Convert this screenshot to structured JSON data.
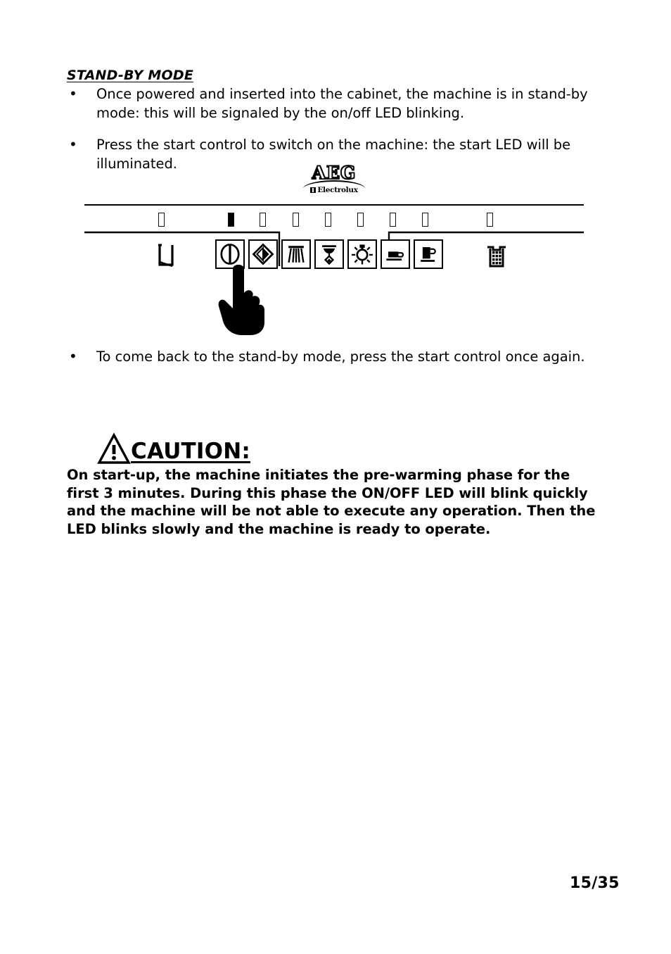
{
  "document": {
    "section_heading": "STAND-BY MODE",
    "page_number": "15/35"
  },
  "bullets": [
    {
      "marker": "•",
      "text": "Once powered and inserted into the cabinet, the machine is in stand-by mode: this will be signaled by the on/off LED blinking."
    },
    {
      "marker": "•",
      "text": "Press the start control to switch on the machine: the start LED will be illuminated."
    },
    {
      "marker": "•",
      "text": "To come back to the stand-by mode, press the start control once again."
    }
  ],
  "figure": {
    "brand": {
      "name": "AEG",
      "sub": "Electrolux"
    },
    "leds": [
      {
        "name": "led-water-tank",
        "state": "off"
      },
      {
        "name": "led-on-off",
        "state": "on"
      },
      {
        "name": "led-rinse",
        "state": "off"
      },
      {
        "name": "led-steam",
        "state": "off"
      },
      {
        "name": "led-hot-water",
        "state": "off"
      },
      {
        "name": "led-descale",
        "state": "off"
      },
      {
        "name": "led-espresso",
        "state": "off"
      },
      {
        "name": "led-lungo",
        "state": "off"
      },
      {
        "name": "led-grounds-drawer",
        "state": "off"
      }
    ],
    "buttons": [
      {
        "name": "power-on-off-button",
        "icon": "power-icon"
      },
      {
        "name": "rinse-button",
        "icon": "diamond-icon"
      },
      {
        "name": "steam-button",
        "icon": "steam-jets-icon"
      },
      {
        "name": "hot-water-button",
        "icon": "tap-pour-icon"
      },
      {
        "name": "descale-button",
        "icon": "sun-lamp-icon"
      },
      {
        "name": "espresso-button",
        "icon": "small-cup-icon"
      },
      {
        "name": "lungo-button",
        "icon": "tall-cup-icon"
      }
    ],
    "side_symbols": [
      {
        "name": "water-tank-symbol",
        "icon": "tank-icon"
      },
      {
        "name": "grounds-drawer-symbol",
        "icon": "grounds-basket-icon"
      }
    ],
    "pointer": {
      "name": "pointing-hand-cursor",
      "icon": "hand-pointer-icon"
    }
  },
  "caution": {
    "icon": "warning-triangle-icon",
    "title": "CAUTION:",
    "body": "On start-up, the machine initiates the pre-warming phase for the first 3 minutes. During this phase the ON/OFF LED will blink quickly and the machine will be not able to execute any operation. Then the LED blinks slowly and the machine is ready to operate."
  },
  "colors": {
    "ink": "#000000",
    "paper": "#ffffff"
  }
}
